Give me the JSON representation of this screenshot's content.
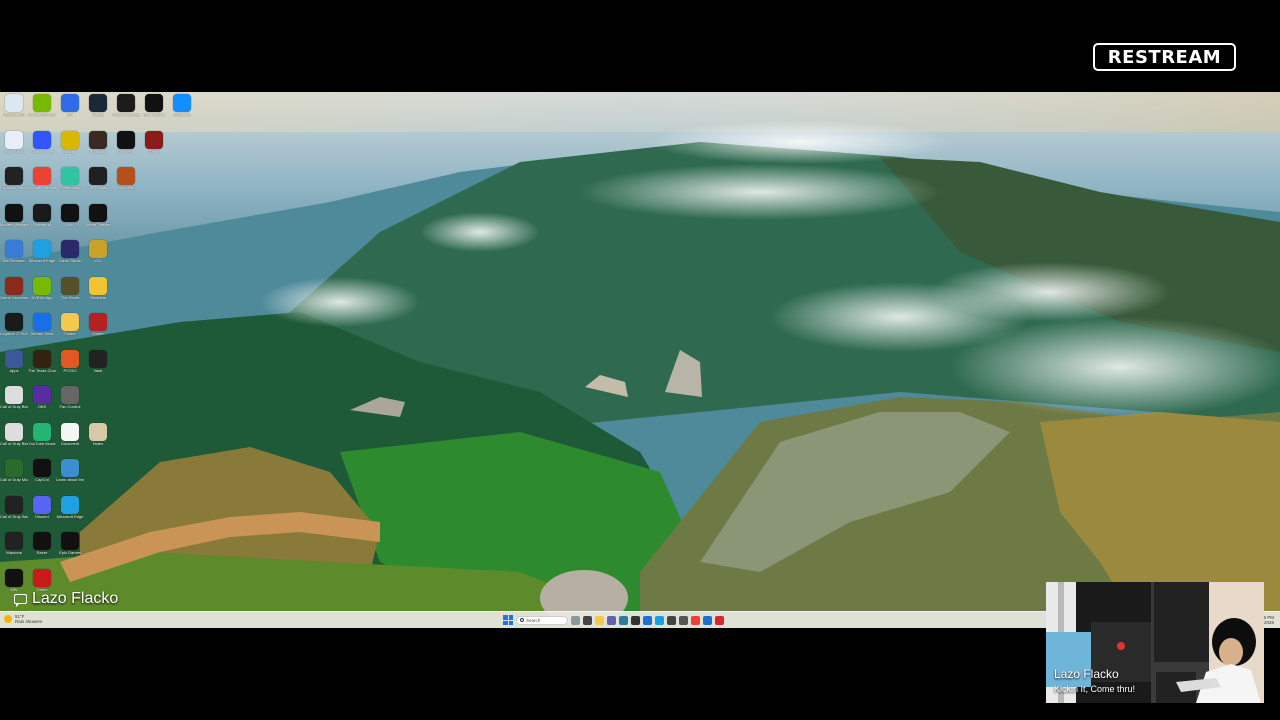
{
  "brand": {
    "logo_text": "RESTREAM"
  },
  "desktop": {
    "icons": [
      {
        "label": "Recycle Bin",
        "icon": "recycle-bin-icon",
        "color": "#d9e8f2"
      },
      {
        "label": "Nvidia GeForce",
        "icon": "nvidia-icon",
        "color": "#76b900"
      },
      {
        "label": "EA",
        "icon": "ea-icon",
        "color": "#2f6ce5"
      },
      {
        "label": "Steam",
        "icon": "steam-icon",
        "color": "#1b2838"
      },
      {
        "label": "Ubisoft Connect",
        "icon": "ubisoft-icon",
        "color": "#1c1c1c"
      },
      {
        "label": "Epic Games",
        "icon": "epic-icon",
        "color": "#111111"
      },
      {
        "label": "Battle.net",
        "icon": "battlenet-icon",
        "color": "#148eff"
      },
      {
        "label": "Lazo Flacko",
        "icon": "folder-app-icon",
        "color": "#e8eef7"
      },
      {
        "label": "Roblox Player",
        "icon": "roblox-icon",
        "color": "#3155ff"
      },
      {
        "label": "Valorant",
        "icon": "valorant-icon",
        "color": "#d8b800"
      },
      {
        "label": "Bloxstrap",
        "icon": "game-icon",
        "color": "#3a2a22"
      },
      {
        "label": "Overwolf",
        "icon": "overwolf-icon",
        "color": "#111111"
      },
      {
        "label": "Game",
        "icon": "game-icon",
        "color": "#8b1a1a"
      },
      {
        "label": "",
        "icon": "blank-icon",
        "color": "rgba(0,0,0,0)"
      },
      {
        "label": "Rockstar Games",
        "icon": "game-icon",
        "color": "#222222"
      },
      {
        "label": "Google Chrome",
        "icon": "chrome-icon",
        "color": "#ea4335"
      },
      {
        "label": "Streamlabs",
        "icon": "streamlabs-icon",
        "color": "#31c3a2"
      },
      {
        "label": "OBS Studio",
        "icon": "obs-icon",
        "color": "#202020"
      },
      {
        "label": "Mod Menu",
        "icon": "game-icon",
        "color": "#b5501c"
      },
      {
        "label": "",
        "icon": "blank-icon",
        "color": "rgba(0,0,0,0)"
      },
      {
        "label": "",
        "icon": "blank-icon",
        "color": "rgba(0,0,0,0)"
      },
      {
        "label": "Modern Warfare",
        "icon": "cod-icon",
        "color": "#111111"
      },
      {
        "label": "Voicemod",
        "icon": "voicemod-icon",
        "color": "#1a1a1a"
      },
      {
        "label": "Arc",
        "icon": "app-icon",
        "color": "#111111"
      },
      {
        "label": "Arena Tracker",
        "icon": "app-icon",
        "color": "#111111"
      },
      {
        "label": "",
        "icon": "blank-icon",
        "color": "rgba(0,0,0,0)"
      },
      {
        "label": "",
        "icon": "blank-icon",
        "color": "rgba(0,0,0,0)"
      },
      {
        "label": "",
        "icon": "blank-icon",
        "color": "rgba(0,0,0,0)"
      },
      {
        "label": "Arc Browser",
        "icon": "app-icon",
        "color": "#3a7bd5"
      },
      {
        "label": "Microsoft Edge",
        "icon": "edge-icon",
        "color": "#1fa0e0"
      },
      {
        "label": "Camo Studio",
        "icon": "app-icon",
        "color": "#2a2a6a"
      },
      {
        "label": "VLC",
        "icon": "app-icon",
        "color": "#c9a227"
      },
      {
        "label": "",
        "icon": "blank-icon",
        "color": "rgba(0,0,0,0)"
      },
      {
        "label": "",
        "icon": "blank-icon",
        "color": "rgba(0,0,0,0)"
      },
      {
        "label": "",
        "icon": "blank-icon",
        "color": "rgba(0,0,0,0)"
      },
      {
        "label": "Game Launcher",
        "icon": "game-icon",
        "color": "#8b2a1a"
      },
      {
        "label": "NVIDIA App",
        "icon": "nvidia-icon",
        "color": "#76b900"
      },
      {
        "label": "The Finals",
        "icon": "game-icon",
        "color": "#55502a"
      },
      {
        "label": "Rockstar",
        "icon": "rockstar-icon",
        "color": "#f4c430"
      },
      {
        "label": "",
        "icon": "blank-icon",
        "color": "rgba(0,0,0,0)"
      },
      {
        "label": "",
        "icon": "blank-icon",
        "color": "rgba(0,0,0,0)"
      },
      {
        "label": "",
        "icon": "blank-icon",
        "color": "rgba(0,0,0,0)"
      },
      {
        "label": "Logitech G HUB",
        "icon": "ghub-icon",
        "color": "#1a1a1a"
      },
      {
        "label": "Stream Deck",
        "icon": "app-icon",
        "color": "#1a6ee8"
      },
      {
        "label": "Folder",
        "icon": "folder-icon",
        "color": "#f2c94c"
      },
      {
        "label": "Game",
        "icon": "game-icon",
        "color": "#b22222"
      },
      {
        "label": "",
        "icon": "blank-icon",
        "color": "rgba(0,0,0,0)"
      },
      {
        "label": "",
        "icon": "blank-icon",
        "color": "rgba(0,0,0,0)"
      },
      {
        "label": "",
        "icon": "blank-icon",
        "color": "rgba(0,0,0,0)"
      },
      {
        "label": "Apps",
        "icon": "app-icon",
        "color": "#3b5998"
      },
      {
        "label": "The Texas Chain Saw",
        "icon": "game-icon",
        "color": "#332211"
      },
      {
        "label": "PCSX2",
        "icon": "game-icon",
        "color": "#e25822"
      },
      {
        "label": "Vault",
        "icon": "app-icon",
        "color": "#222222"
      },
      {
        "label": "",
        "icon": "blank-icon",
        "color": "rgba(0,0,0,0)"
      },
      {
        "label": "",
        "icon": "blank-icon",
        "color": "rgba(0,0,0,0)"
      },
      {
        "label": "",
        "icon": "blank-icon",
        "color": "rgba(0,0,0,0)"
      },
      {
        "label": "Call of Duty Black Ops",
        "icon": "cod-icon",
        "color": "#dddddd"
      },
      {
        "label": "OBS",
        "icon": "obs-icon",
        "color": "#5a2ca0"
      },
      {
        "label": "Fan Control",
        "icon": "app-icon",
        "color": "#666666"
      },
      {
        "label": "",
        "icon": "blank-icon",
        "color": "rgba(0,0,0,0)"
      },
      {
        "label": "",
        "icon": "blank-icon",
        "color": "rgba(0,0,0,0)"
      },
      {
        "label": "",
        "icon": "blank-icon",
        "color": "rgba(0,0,0,0)"
      },
      {
        "label": "",
        "icon": "blank-icon",
        "color": "rgba(0,0,0,0)"
      },
      {
        "label": "Call of Duty Black Ops",
        "icon": "cod-icon",
        "color": "#dddddd"
      },
      {
        "label": "YouTube Music",
        "icon": "app-icon",
        "color": "#22b573"
      },
      {
        "label": "Document",
        "icon": "document-icon",
        "color": "#f5f5f5"
      },
      {
        "label": "Notes",
        "icon": "app-icon",
        "color": "#d8c8a8"
      },
      {
        "label": "",
        "icon": "blank-icon",
        "color": "rgba(0,0,0,0)"
      },
      {
        "label": "",
        "icon": "blank-icon",
        "color": "rgba(0,0,0,0)"
      },
      {
        "label": "",
        "icon": "blank-icon",
        "color": "rgba(0,0,0,0)"
      },
      {
        "label": "Call of Duty Modern",
        "icon": "cod-icon",
        "color": "#2a6a2a"
      },
      {
        "label": "CapCut",
        "icon": "capcut-icon",
        "color": "#111111"
      },
      {
        "label": "Learn about this picture",
        "icon": "picture-icon",
        "color": "#3b8fd0"
      },
      {
        "label": "",
        "icon": "blank-icon",
        "color": "rgba(0,0,0,0)"
      },
      {
        "label": "",
        "icon": "blank-icon",
        "color": "rgba(0,0,0,0)"
      },
      {
        "label": "",
        "icon": "blank-icon",
        "color": "rgba(0,0,0,0)"
      },
      {
        "label": "",
        "icon": "blank-icon",
        "color": "rgba(0,0,0,0)"
      },
      {
        "label": "Call of Duty Warzone",
        "icon": "cod-icon",
        "color": "#222222"
      },
      {
        "label": "Discord",
        "icon": "discord-icon",
        "color": "#5865f2"
      },
      {
        "label": "Microsoft Edge",
        "icon": "edge-icon",
        "color": "#1fa0e0"
      },
      {
        "label": "",
        "icon": "blank-icon",
        "color": "rgba(0,0,0,0)"
      },
      {
        "label": "",
        "icon": "blank-icon",
        "color": "rgba(0,0,0,0)"
      },
      {
        "label": "",
        "icon": "blank-icon",
        "color": "rgba(0,0,0,0)"
      },
      {
        "label": "",
        "icon": "blank-icon",
        "color": "rgba(0,0,0,0)"
      },
      {
        "label": "Warzone",
        "icon": "cod-icon",
        "color": "#222222"
      },
      {
        "label": "Razer",
        "icon": "razer-icon",
        "color": "#111111"
      },
      {
        "label": "Epic Games",
        "icon": "epic-icon",
        "color": "#111111"
      },
      {
        "label": "",
        "icon": "blank-icon",
        "color": "rgba(0,0,0,0)"
      },
      {
        "label": "",
        "icon": "blank-icon",
        "color": "rgba(0,0,0,0)"
      },
      {
        "label": "",
        "icon": "blank-icon",
        "color": "rgba(0,0,0,0)"
      },
      {
        "label": "",
        "icon": "blank-icon",
        "color": "rgba(0,0,0,0)"
      },
      {
        "label": "MW",
        "icon": "mw-icon",
        "color": "#111111"
      },
      {
        "label": "Game",
        "icon": "game-icon",
        "color": "#c81a1a"
      }
    ]
  },
  "taskbar": {
    "weather_temp": "51°F",
    "weather_desc": "Rain showers",
    "search_placeholder": "Search",
    "apps": [
      {
        "icon": "copilot-icon",
        "color": "#8a9a9a"
      },
      {
        "icon": "task-view-icon",
        "color": "#444444"
      },
      {
        "icon": "file-explorer-icon",
        "color": "#f2c94c"
      },
      {
        "icon": "teams-icon",
        "color": "#6264a7"
      },
      {
        "icon": "store-icon",
        "color": "#2d7d9a"
      },
      {
        "icon": "app-icon",
        "color": "#333333"
      },
      {
        "icon": "app-icon",
        "color": "#1f6fd1"
      },
      {
        "icon": "app-icon",
        "color": "#1aa0e0"
      },
      {
        "icon": "app-icon",
        "color": "#444444"
      },
      {
        "icon": "settings-icon",
        "color": "#555555"
      },
      {
        "icon": "chrome-icon",
        "color": "#ea4335"
      },
      {
        "icon": "mail-icon",
        "color": "#1f6fd1"
      },
      {
        "icon": "app-icon",
        "color": "#d7262f"
      }
    ],
    "clock_time": "4:15 PM",
    "clock_date": "1/23/2026"
  },
  "overlay": {
    "chat_username": "Lazo Flacko"
  },
  "webcam": {
    "name": "Lazo Flacko",
    "status": "Kickin It, Come thru!"
  }
}
